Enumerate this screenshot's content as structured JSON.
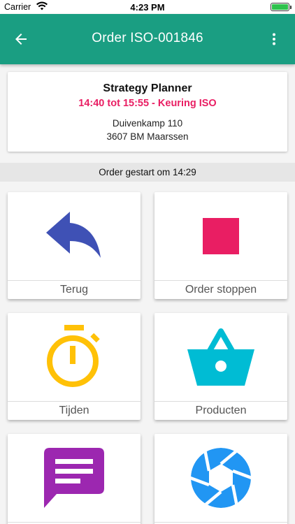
{
  "status_bar": {
    "carrier": "Carrier",
    "time": "4:23 PM",
    "battery_level": 1.0,
    "battery_color": "#2ec24d"
  },
  "app_bar": {
    "title": "Order ISO-001846",
    "back_icon": "arrow-left-icon",
    "menu_icon": "more-vertical-icon",
    "background_color": "#1a9e82"
  },
  "order_info": {
    "company": "Strategy Planner",
    "timeslot": "14:40 tot 15:55 - Keuring ISO",
    "timeslot_color": "#e91e63",
    "address_line1": "Duivenkamp 110",
    "address_line2": "3607 BM Maarssen"
  },
  "order_status": "Order gestart om 14:29",
  "tiles": [
    {
      "label": "Terug",
      "icon": "reply-arrow-icon",
      "color": "#3f51b5"
    },
    {
      "label": "Order stoppen",
      "icon": "stop-square-icon",
      "color": "#e91e63"
    },
    {
      "label": "Tijden",
      "icon": "stopwatch-icon",
      "color": "#ffc107"
    },
    {
      "label": "Producten",
      "icon": "basket-icon",
      "color": "#00bcd4"
    },
    {
      "label": "",
      "icon": "message-icon",
      "color": "#9c27b0"
    },
    {
      "label": "",
      "icon": "camera-shutter-icon",
      "color": "#2196f3"
    }
  ]
}
